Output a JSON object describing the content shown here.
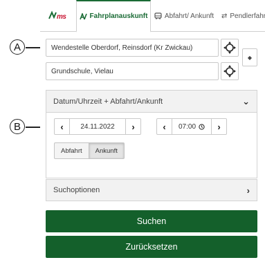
{
  "annotations": {
    "a": "A",
    "b": "B"
  },
  "tabs": {
    "logo": "VMS",
    "fahrplan": "Fahrplanauskunft",
    "abfahrt": "Abfahrt/ Ankunft",
    "pendler": "Pendlerfahr"
  },
  "stations": {
    "from": "Wendestelle Oberdorf, Reinsdorf (Kr Zwickau)",
    "to": "Grundschule, Vielau"
  },
  "datetime": {
    "panel_title": "Datum/Uhrzeit + Abfahrt/Ankunft",
    "date": "24.11.2022",
    "time": "07:00",
    "departure_label": "Abfahrt",
    "arrival_label": "Ankunft",
    "selected": "Ankunft"
  },
  "search_options": {
    "label": "Suchoptionen"
  },
  "actions": {
    "search_label": "Suchen",
    "reset_label": "Zurücksetzen"
  },
  "colors": {
    "brand_green": "#14602b",
    "brand_red": "#c8102e"
  }
}
